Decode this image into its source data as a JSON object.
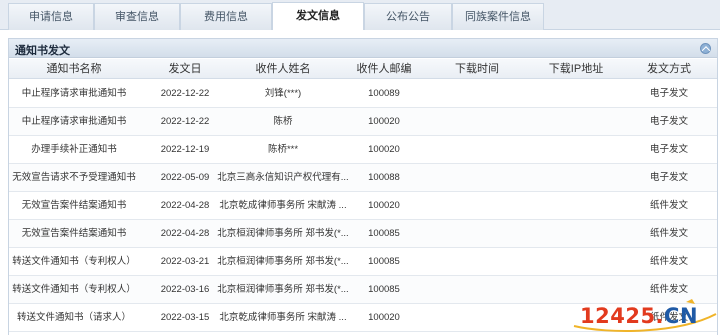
{
  "tabs": [
    {
      "label": "申请信息",
      "active": false
    },
    {
      "label": "审查信息",
      "active": false
    },
    {
      "label": "费用信息",
      "active": false
    },
    {
      "label": "发文信息",
      "active": true
    },
    {
      "label": "公布公告",
      "active": false
    },
    {
      "label": "同族案件信息",
      "active": false
    }
  ],
  "panel": {
    "title": "通知书发文",
    "collapse_icon": "collapse-up-icon"
  },
  "table": {
    "headers": [
      "通知书名称",
      "发文日",
      "收件人姓名",
      "收件人邮编",
      "下载时间",
      "下载IP地址",
      "发文方式"
    ],
    "rows": [
      [
        "中止程序请求审批通知书",
        "2022-12-22",
        "刘锋(***)",
        "100089",
        "",
        "",
        "电子发文"
      ],
      [
        "中止程序请求审批通知书",
        "2022-12-22",
        "陈桥",
        "100020",
        "",
        "",
        "电子发文"
      ],
      [
        "办理手续补正通知书",
        "2022-12-19",
        "陈桥***",
        "100020",
        "",
        "",
        "电子发文"
      ],
      [
        "无效宣告请求不予受理通知书",
        "2022-05-09",
        "北京三高永信知识产权代理有...",
        "100088",
        "",
        "",
        "电子发文"
      ],
      [
        "无效宣告案件结案通知书",
        "2022-04-28",
        "北京乾成律师事务所 宋献涛 ...",
        "100020",
        "",
        "",
        "纸件发文"
      ],
      [
        "无效宣告案件结案通知书",
        "2022-04-28",
        "北京桓润律师事务所 郑书发(*...",
        "100085",
        "",
        "",
        "纸件发文"
      ],
      [
        "转送文件通知书（专利权人）",
        "2022-03-21",
        "北京桓润律师事务所 郑书发(*...",
        "100085",
        "",
        "",
        "纸件发文"
      ],
      [
        "转送文件通知书（专利权人）",
        "2022-03-16",
        "北京桓润律师事务所 郑书发(*...",
        "100085",
        "",
        "",
        "纸件发文"
      ],
      [
        "转送文件通知书（请求人）",
        "2022-03-15",
        "北京乾成律师事务所 宋献涛 ...",
        "100020",
        "",
        "",
        "纸件发文"
      ]
    ]
  },
  "watermark": {
    "text_red": "12425.",
    "text_blue": "CN"
  },
  "colors": {
    "tab_bg": "#e7ecf3",
    "panel_header": "#d3deea",
    "watermark_red": "#e23a1e",
    "watermark_blue": "#1f5aa6"
  }
}
